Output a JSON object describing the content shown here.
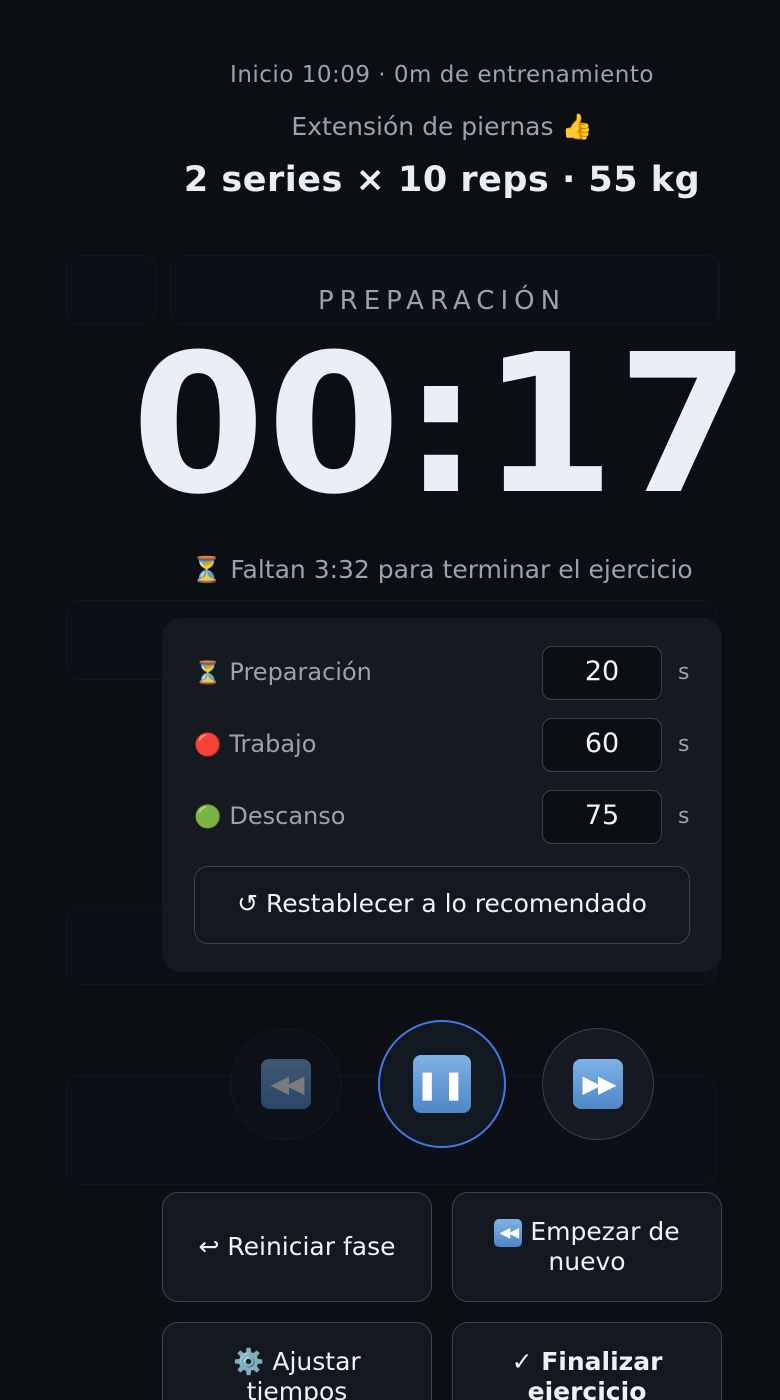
{
  "header": {
    "meta": "Inicio 10:09 · 0m de entrenamiento",
    "exercise": "Extensión de piernas 👍",
    "summary": "2 series × 10 reps · 55 kg"
  },
  "timer": {
    "phase": "PREPARACIÓN",
    "display": "00:17",
    "remaining": "⏳ Faltan 3:32 para terminar el ejercicio"
  },
  "settings": {
    "rows": [
      {
        "emoji": "⏳",
        "label": "Preparación",
        "value": "20",
        "unit": "s"
      },
      {
        "emoji": "🔴",
        "label": "Trabajo",
        "value": "60",
        "unit": "s"
      },
      {
        "emoji": "🟢",
        "label": "Descanso",
        "value": "75",
        "unit": "s"
      }
    ],
    "reset_label": "↺ Restablecer a lo recomendado"
  },
  "controls": {
    "prev_icon": "skip-back-icon",
    "pause_icon": "pause-icon",
    "next_icon": "skip-forward-icon",
    "accent_color": "#3d7be0"
  },
  "actions": {
    "restart_phase": "↩ Reiniciar fase",
    "start_over_icon": "⏮️",
    "start_over": "Empezar de nuevo",
    "adjust_times": "⚙️ Ajustar tiempos",
    "finish_exercise": "✓ Finalizar ejercicio"
  }
}
